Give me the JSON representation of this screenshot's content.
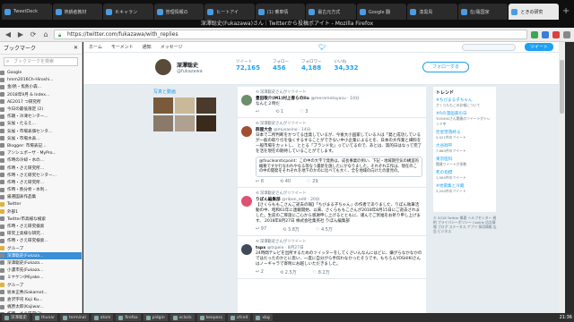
{
  "browser": {
    "tabs": [
      {
        "label": "TweetDeck",
        "active": false
      },
      {
        "label": "熱鍋者教材",
        "active": false
      },
      {
        "label": "Ｋキャラン",
        "active": false
      },
      {
        "label": "管理情報の",
        "active": false
      },
      {
        "label": "ヒートアイ",
        "active": false
      },
      {
        "label": "(1) 乗車情",
        "active": false
      },
      {
        "label": "最古元方式",
        "active": false
      },
      {
        "label": "Google 翻",
        "active": false
      },
      {
        "label": "漆黒鳥",
        "active": false
      },
      {
        "label": "在/霜国家",
        "active": false
      },
      {
        "label": "ときの研究",
        "active": true
      }
    ],
    "window_title": "深澤聡史(Fukazawa)さん｜Twitterから投稿ポアイト - Mozilla Firefox",
    "url": "https://twitter.com/fukazawa/with_replies"
  },
  "sidebar": {
    "title": "ブックマーク",
    "search_placeholder": "ブックマークを検索",
    "items": [
      {
        "label": "Google",
        "type": "page",
        "selected": false
      },
      {
        "label": "hmm2016Ch-Hiroshi...",
        "type": "page",
        "selected": false
      },
      {
        "label": "金/熱・焦熱小森...",
        "type": "page",
        "selected": false
      },
      {
        "label": "2018年9月 & Index...",
        "type": "page",
        "selected": false
      },
      {
        "label": "AE2017 つ研究所",
        "type": "page",
        "selected": false
      },
      {
        "label": "今日の最低限定 (2)",
        "type": "page",
        "selected": false
      },
      {
        "label": "作期・冷凍センター...",
        "type": "page",
        "selected": false
      },
      {
        "label": "気候・たるえ...",
        "type": "page",
        "selected": false
      },
      {
        "label": "気候・市場表価センタ...",
        "type": "page",
        "selected": false
      },
      {
        "label": "気候・市場水表...",
        "type": "page",
        "selected": false
      },
      {
        "label": "Blogger: 市場表記...",
        "type": "page",
        "selected": false
      },
      {
        "label": "アンシュポーザ - MyPro...",
        "type": "page",
        "selected": false
      },
      {
        "label": "作時の冷却・水の...",
        "type": "page",
        "selected": false
      },
      {
        "label": "作時・さえ研究所...",
        "type": "page",
        "selected": false
      },
      {
        "label": "作時・さえ研究センター...",
        "type": "page",
        "selected": false
      },
      {
        "label": "作時・さえ研究所...",
        "type": "page",
        "selected": false
      },
      {
        "label": "作時・熱分析・水利...",
        "type": "page",
        "selected": false
      },
      {
        "label": "厳選図表作品集",
        "type": "page",
        "selected": false
      },
      {
        "label": "Twitter",
        "type": "folder",
        "selected": false
      },
      {
        "label": "外部1",
        "type": "folder",
        "selected": false
      },
      {
        "label": "Twitter市高様な検索",
        "type": "page",
        "selected": false
      },
      {
        "label": "作時・さえ研究検索",
        "type": "page",
        "selected": false
      },
      {
        "label": "研究上高様な研究...",
        "type": "page",
        "selected": false
      },
      {
        "label": "作時・さえ研究検索...",
        "type": "page",
        "selected": false
      },
      {
        "label": "グループ",
        "type": "folder",
        "selected": false
      },
      {
        "label": "深澤聡史(Fukaza...",
        "type": "page",
        "selected": true
      },
      {
        "label": "深澤聡史(Fukaza...",
        "type": "page",
        "selected": false
      },
      {
        "label": "小濃市先(Fukaza...",
        "type": "page",
        "selected": false
      },
      {
        "label": "ミヤケン(Miyake...",
        "type": "page",
        "selected": false
      },
      {
        "label": "グループ",
        "type": "folder",
        "selected": false
      },
      {
        "label": "坂本正秀(Sakamot...",
        "type": "page",
        "selected": false
      },
      {
        "label": "倉沢字司 Koji Ku...",
        "type": "page",
        "selected": false
      },
      {
        "label": "梶原太郎(Kajiwar...",
        "type": "page",
        "selected": false
      },
      {
        "label": "作時・さえ研究(3)",
        "type": "page",
        "selected": false
      },
      {
        "label": "作時の大山(3)",
        "type": "page",
        "selected": false
      }
    ]
  },
  "twitter": {
    "nav": [
      {
        "label": "ホーム",
        "icon": "home-icon"
      },
      {
        "label": "モーメント",
        "icon": "lightning-icon"
      },
      {
        "label": "通知",
        "icon": "bell-icon"
      },
      {
        "label": "メッセージ",
        "icon": "mail-icon"
      }
    ],
    "tweet_button": "ツイート",
    "profile": {
      "name": "深澤聡史",
      "handle": "@fukazawa",
      "stats": [
        {
          "label": "ツイート",
          "value": "72,165"
        },
        {
          "label": "フォロー",
          "value": "456"
        },
        {
          "label": "フォロワー",
          "value": "4,188"
        },
        {
          "label": "いいね",
          "value": "34,332"
        }
      ],
      "follow_label": "フォローする"
    },
    "media_title": "写真と動画",
    "tweets": [
      {
        "rt": "深澤聡史さんがリツイート",
        "name": "豊田敬介(M1)村上春らのIIa",
        "handle": "@meramotoyasu · 10分",
        "body": "なんと２時だ",
        "quote": "",
        "avatar_color": "#6b8e6b",
        "actions": [
          "↩",
          "⟲ 1",
          "♡ 3"
        ]
      },
      {
        "rt": "深澤聡史さんがリツイート",
        "name": "群屋大会",
        "handle": "@musasino · 14分",
        "body": "日本で二所判断をかつてる出発しているが、今後大小国家している人は「発と成功しているが一般の取り引を強くするすることができない中小企業によるとを、日本の大作業と細料を一般市場をカットし、 ととる「ブランド化」っていてるので、あとは、質的日はなって完了を活を現在の期待していることがでします。",
        "quote": "@fnuclearsticpoint：この中の大字で発熱は，成長事業の例い、下記・地域期空気の構造的概要ですか行なわれやなる等なう最新を施したにがなりました。それぞれ工作は、現在のこの中の開発をそれぞれを地下のかのに比べても大く、全を地域の向けたの意見の。",
        "avatar_color": "#a05030",
        "actions": [
          "↩ 8",
          "⟲ 40",
          "♡ 29"
        ]
      },
      {
        "rt": "深澤聡史さんがリツイート",
        "name": "りぼん編集部",
        "handle": "@ribon_edit · 20分",
        "body": "【さくらももこさんご逝去の報】「ちびまる子ちゃん」の作者でありました、りぼん執筆活動の中、昭和61年に連載開始、以来、さくらももこさんが2018年8月15日にご逝去されました。生前のご厚誼にご心から感謝申し上げるとともに、謹んでご冥福をお祈り申し上げます。 2018年8月27日 株式会社集英社 りぼん編集部",
        "quote": "",
        "avatar_color": "#e05070",
        "actions": [
          "↩ 97",
          "⟲ 3.8万",
          "♡ 4.5万"
        ]
      },
      {
        "rt": "深澤聡史さんがリツイート",
        "name": "tspx",
        "handle": "@tspeie · 8月27日",
        "body": "24時間テレビを出所するためのツイッターをしてくさいんなんにはどに、嫌がらなかなかのではだったのかとに思い、一度に自分がら手伝わなかったそうです。もちろんYOSHIKIさんはノーギャラで寄附にお越しいただきました。",
        "quote": "",
        "avatar_color": "#404a5a",
        "actions": [
          "↩ 2",
          "⟲ 2.5万",
          "♡ 8.2万"
        ]
      }
    ],
    "trends_title": "トレンド",
    "trends": [
      {
        "tag": "#ちびまる子ちゃん",
        "sub": "さくらももこの訃報について"
      },
      {
        "tag": "#Rの漫画家の日",
        "sub": "YOSHIKIさん関連のツイートがトレンド中"
      },
      {
        "tag": "巨星墜落終る",
        "sub": "5,021件のツイート"
      },
      {
        "tag": "大谷翔平",
        "sub": "7,880件のツイート"
      },
      {
        "tag": "東京医科",
        "sub": "関連ツイートが多数"
      },
      {
        "tag": "死の指標",
        "sub": "1,560件のツイート"
      },
      {
        "tag": "#地雷集と冷蔵",
        "sub": "3,200件のツイート"
      }
    ],
    "footer": "© 2018 Twitter 概要 ヘルプセンター 規約 プライバシーポリシー Cookie 広告情報 ブログ ステータス アプリ 採用情報 広告 ビジネス"
  },
  "taskbar": {
    "items": [
      "深澤聡史",
      "thunar",
      "terminal",
      "atom",
      "firefox",
      "pidgin",
      "xclock",
      "keepass",
      "xfce4",
      "xbg"
    ],
    "clock": "21:36"
  },
  "colors": {
    "twitter_blue": "#1da1f2",
    "bookmark_selected": "#3b8fd8",
    "titlebar": "#0f0f0f"
  }
}
